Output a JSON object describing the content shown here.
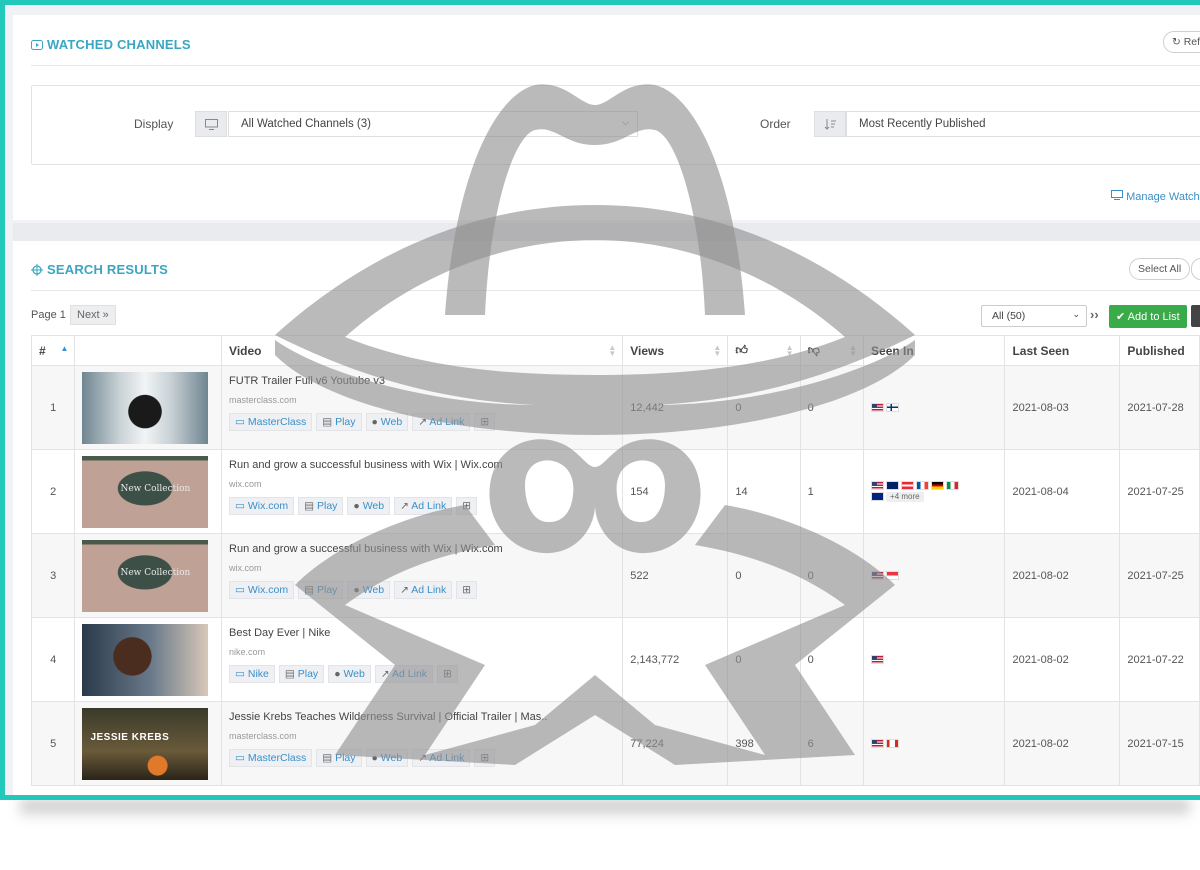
{
  "watched": {
    "title": "WATCHED CHANNELS",
    "refresh_label": "Ref",
    "display_label": "Display",
    "display_value": "All Watched Channels (3)",
    "order_label": "Order",
    "order_value": "Most Recently Published",
    "manage_link": "Manage Watch"
  },
  "results": {
    "title": "SEARCH RESULTS",
    "select_all": "Select All",
    "page_label": "Page 1",
    "next_label": "Next »",
    "page_size": "All (50)",
    "add_to_list": "Add to List",
    "columns": [
      "#",
      "",
      "Video",
      "Views",
      "",
      "",
      "Seen In",
      "Last Seen",
      "Published"
    ],
    "rows": [
      {
        "n": "1",
        "title": "FUTR Trailer Full v6 Youtube v3",
        "domain": "masterclass.com",
        "channel": "MasterClass",
        "views": "12,442",
        "likes": "0",
        "dislikes": "0",
        "flags": [
          "us",
          "fi"
        ],
        "more": "",
        "last_seen": "2021-08-03",
        "published": "2021-07-28"
      },
      {
        "n": "2",
        "title": "Run and grow a successful business with Wix | Wix.com",
        "domain": "wix.com",
        "channel": "Wix.com",
        "views": "154",
        "likes": "14",
        "dislikes": "1",
        "flags": [
          "us",
          "au",
          "at",
          "fr",
          "de",
          "it",
          "nz"
        ],
        "more": "+4 more",
        "last_seen": "2021-08-04",
        "published": "2021-07-25"
      },
      {
        "n": "3",
        "title": "Run and grow a successful business with Wix | Wix.com",
        "domain": "wix.com",
        "channel": "Wix.com",
        "views": "522",
        "likes": "0",
        "dislikes": "0",
        "flags": [
          "us",
          "sg"
        ],
        "more": "",
        "last_seen": "2021-08-02",
        "published": "2021-07-25"
      },
      {
        "n": "4",
        "title": "Best Day Ever | Nike",
        "domain": "nike.com",
        "channel": "Nike",
        "views": "2,143,772",
        "likes": "0",
        "dislikes": "0",
        "flags": [
          "us"
        ],
        "more": "",
        "last_seen": "2021-08-02",
        "published": "2021-07-22"
      },
      {
        "n": "5",
        "title": "Jessie Krebs Teaches Wilderness Survival | Official Trailer | Mas..",
        "domain": "masterclass.com",
        "channel": "MasterClass",
        "views": "77,224",
        "likes": "398",
        "dislikes": "6",
        "flags": [
          "us",
          "ca"
        ],
        "more": "",
        "last_seen": "2021-08-02",
        "published": "2021-07-15"
      }
    ],
    "action_labels": {
      "play": "Play",
      "web": "Web",
      "ad_link": "Ad Link"
    },
    "thumb_text_5": "JESSIE KREBS",
    "thumb_text_wix": "New Collection"
  },
  "colors": {
    "accent_teal": "#22c9bb",
    "title_blue": "#3aa6c2",
    "link_blue": "#3a8fc8",
    "add_green": "#3aab49"
  }
}
